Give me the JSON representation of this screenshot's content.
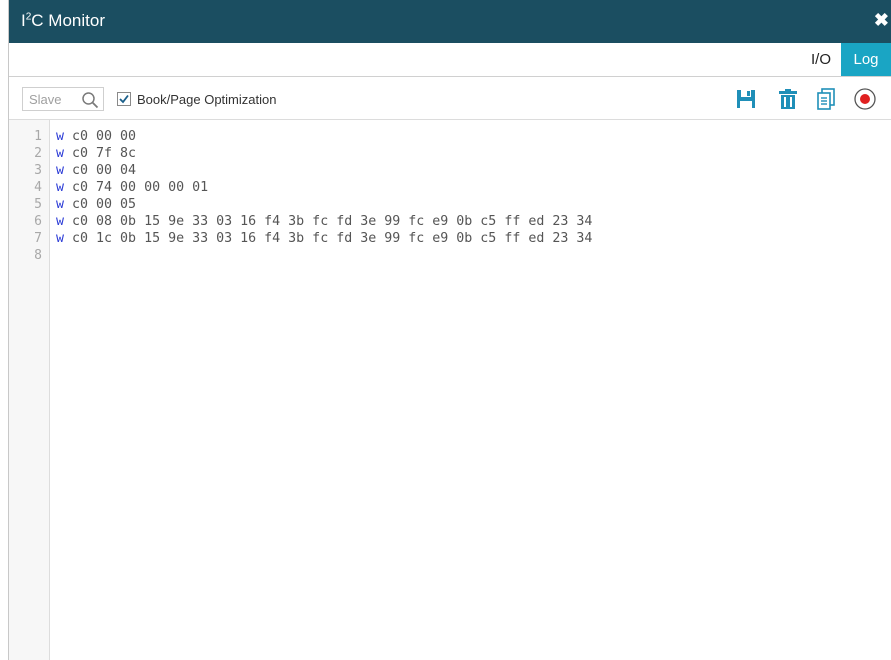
{
  "window": {
    "title_prefix": "I",
    "title_sup": "2",
    "title_suffix": "C Monitor",
    "close_glyph": "✖"
  },
  "tabs": [
    {
      "label": "I/O",
      "active": false
    },
    {
      "label": "Log",
      "active": true
    }
  ],
  "toolbar": {
    "search_placeholder": "Slave",
    "checkbox_label": "Book/Page Optimization",
    "checkbox_checked": true,
    "icons": [
      "save-icon",
      "trash-icon",
      "copy-icon",
      "record-icon"
    ]
  },
  "colors": {
    "titlebar": "#1b4e61",
    "active_tab": "#1aa5c4",
    "toolbar_icons": "#1f8fb8",
    "record": "#e02020",
    "keyword": "#2b3bd6"
  },
  "log": {
    "lines": [
      {
        "num": "1",
        "op": "w",
        "text": " c0 00 00"
      },
      {
        "num": "2",
        "op": "w",
        "text": " c0 7f 8c"
      },
      {
        "num": "3",
        "op": "w",
        "text": " c0 00 04"
      },
      {
        "num": "4",
        "op": "w",
        "text": " c0 74 00 00 00 01"
      },
      {
        "num": "5",
        "op": "w",
        "text": " c0 00 05"
      },
      {
        "num": "6",
        "op": "w",
        "text": " c0 08 0b 15 9e 33 03 16 f4 3b fc fd 3e 99 fc e9 0b c5 ff ed 23 34"
      },
      {
        "num": "7",
        "op": "w",
        "text": " c0 1c 0b 15 9e 33 03 16 f4 3b fc fd 3e 99 fc e9 0b c5 ff ed 23 34"
      },
      {
        "num": "8",
        "op": "",
        "text": ""
      }
    ]
  }
}
